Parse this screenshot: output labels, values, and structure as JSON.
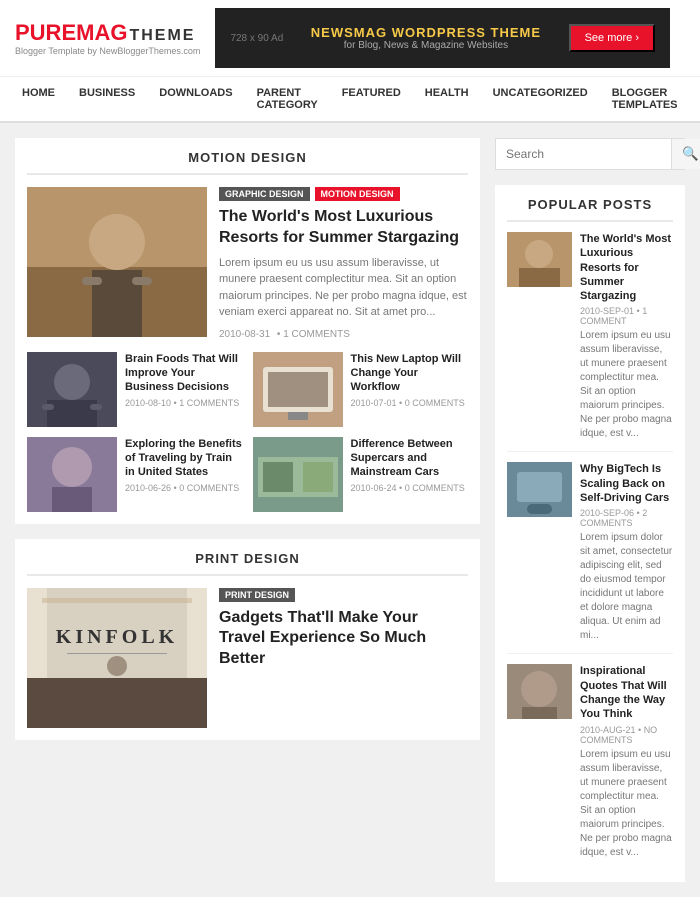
{
  "header": {
    "logo_pure": "PUREMAG",
    "logo_theme": "THEME",
    "logo_sub": "Blogger Template by NewBloggerThemes.com",
    "banner_ad": "728 x 90 Ad",
    "banner_title": "NEWSMAG WORDPRESS THEME",
    "banner_sub": "for Blog, News & Magazine Websites",
    "banner_btn": "See more ›"
  },
  "nav": {
    "items": [
      {
        "label": "HOME",
        "active": false
      },
      {
        "label": "BUSINESS",
        "active": false
      },
      {
        "label": "DOWNLOADS",
        "active": false
      },
      {
        "label": "PARENT CATEGORY",
        "active": false
      },
      {
        "label": "FEATURED",
        "active": false
      },
      {
        "label": "HEALTH",
        "active": false
      },
      {
        "label": "UNCATEGORIZED",
        "active": false
      },
      {
        "label": "BLOGGER TEMPLATES",
        "active": false
      }
    ]
  },
  "motion_design": {
    "section_title": "MOTION DESIGN",
    "featured": {
      "tag1": "GRAPHIC DESIGN",
      "tag2": "MOTION DESIGN",
      "title": "The World's Most Luxurious Resorts for Summer Stargazing",
      "excerpt": "Lorem ipsum eu us usu assum liberavisse, ut munere praesent complectitur mea. Sit an option maiorum principes. Ne per probo magna idque, est veniam exerci appareat no. Sit at amet pro...",
      "date": "2010-08-31",
      "comments": "1 COMMENTS"
    },
    "grid_posts": [
      {
        "title": "Brain Foods That Will Improve Your Business Decisions",
        "date": "2010-08-10",
        "comments": "1 COMMENTS"
      },
      {
        "title": "This New Laptop Will Change Your Workflow",
        "date": "2010-07-01",
        "comments": "0 COMMENTS"
      },
      {
        "title": "Exploring the Benefits of Traveling by Train in United States",
        "date": "2010-06-26",
        "comments": "0 COMMENTS"
      },
      {
        "title": "Difference Between Supercars and Mainstream Cars",
        "date": "2010-06-24",
        "comments": "0 COMMENTS"
      }
    ]
  },
  "print_design": {
    "section_title": "PRINT DESIGN",
    "featured": {
      "tag": "PRINT DESIGN",
      "title": "Gadgets That'll Make Your Travel Experience So Much Better"
    }
  },
  "sidebar": {
    "search_placeholder": "Search",
    "popular_title": "Popular Posts",
    "popular_posts": [
      {
        "title": "The World's Most Luxurious Resorts for Summer Stargazing",
        "date": "2010-SEP-01",
        "comments": "1 COMMENT",
        "excerpt": "Lorem ipsum eu usu assum liberavisse, ut munere praesent complectitur mea. Sit an option maiorum principes. Ne per probo magna idque, est v..."
      },
      {
        "title": "Why BigTech Is Scaling Back on Self-Driving Cars",
        "date": "2010-SEP-06",
        "comments": "2 COMMENTS",
        "excerpt": "Lorem ipsum dolor sit amet, consectetur adipiscing elit, sed do eiusmod tempor incididunt ut labore et dolore magna aliqua. Ut enim ad mi..."
      },
      {
        "title": "Inspirational Quotes That Will Change the Way You Think",
        "date": "2010-AUG-21",
        "comments": "NO COMMENTS",
        "excerpt": "Lorem ipsum eu usu assum liberavisse, ut munere praesent complectitur mea. Sit an option maiorum principes. Ne per probo magna idque, est v..."
      }
    ]
  }
}
